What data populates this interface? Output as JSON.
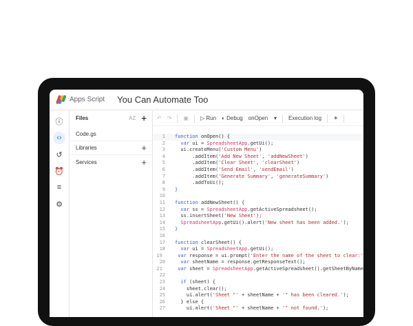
{
  "header": {
    "app_name": "Apps Script",
    "project_title": "You Can Automate Too"
  },
  "rail": [
    {
      "icon": "info-icon",
      "glyph": "ⓘ"
    },
    {
      "icon": "code-icon",
      "glyph": "‹›",
      "active": true
    },
    {
      "icon": "history-icon",
      "glyph": "↺"
    },
    {
      "icon": "triggers-icon",
      "glyph": "⏰"
    },
    {
      "icon": "executions-icon",
      "glyph": "≡"
    },
    {
      "icon": "settings-icon",
      "glyph": "⚙"
    }
  ],
  "files": {
    "title": "Files",
    "sort": "AZ",
    "items": [
      "Code.gs"
    ],
    "libraries": "Libraries",
    "services": "Services"
  },
  "toolbar": {
    "run": "Run",
    "debug": "Debug",
    "function": "onOpen",
    "log": "Execution log"
  },
  "code": [
    [
      [
        "function ",
        "k"
      ],
      [
        "onOpen() {",
        "p"
      ]
    ],
    [
      [
        "  var ",
        "k"
      ],
      [
        "ui = ",
        "p"
      ],
      [
        "SpreadsheetApp",
        "c"
      ],
      [
        ".getUi();",
        "p"
      ]
    ],
    [
      [
        "  ui.createMenu(",
        "p"
      ],
      [
        "'Custom Menu'",
        "s"
      ],
      [
        ")",
        "p"
      ]
    ],
    [
      [
        "      .addItem(",
        "p"
      ],
      [
        "'Add New Sheet'",
        "s"
      ],
      [
        ", ",
        "p"
      ],
      [
        "'addNewSheet'",
        "s"
      ],
      [
        ")",
        "p"
      ]
    ],
    [
      [
        "      .addItem(",
        "p"
      ],
      [
        "'Clear Sheet'",
        "s"
      ],
      [
        ", ",
        "p"
      ],
      [
        "'clearSheet'",
        "s"
      ],
      [
        ")",
        "p"
      ]
    ],
    [
      [
        "      .addItem(",
        "p"
      ],
      [
        "'Send Email'",
        "s"
      ],
      [
        ", ",
        "p"
      ],
      [
        "'sendEmail'",
        "s"
      ],
      [
        ")",
        "p"
      ]
    ],
    [
      [
        "      .addItem(",
        "p"
      ],
      [
        "'Generate Summary'",
        "s"
      ],
      [
        ", ",
        "p"
      ],
      [
        "'generateSummary'",
        "s"
      ],
      [
        ")",
        "p"
      ]
    ],
    [
      [
        "      .addToUi();",
        "p"
      ]
    ],
    [
      [
        "}",
        "k"
      ]
    ],
    [],
    [
      [
        "function ",
        "k"
      ],
      [
        "addNewSheet() {",
        "p"
      ]
    ],
    [
      [
        "  var ",
        "k"
      ],
      [
        "ss = ",
        "p"
      ],
      [
        "SpreadsheetApp",
        "c"
      ],
      [
        ".getActiveSpreadsheet();",
        "p"
      ]
    ],
    [
      [
        "  ss.insertSheet(",
        "p"
      ],
      [
        "'New Sheet'",
        "s"
      ],
      [
        ");",
        "p"
      ]
    ],
    [
      [
        "  SpreadsheetApp",
        "c"
      ],
      [
        ".getUi().alert(",
        "p"
      ],
      [
        "'New sheet has been added.'",
        "s"
      ],
      [
        ");",
        "p"
      ]
    ],
    [
      [
        "}",
        "k"
      ]
    ],
    [],
    [
      [
        "function ",
        "k"
      ],
      [
        "clearSheet() {",
        "p"
      ]
    ],
    [
      [
        "  var ",
        "k"
      ],
      [
        "ui = ",
        "p"
      ],
      [
        "SpreadsheetApp",
        "c"
      ],
      [
        ".getUi();",
        "p"
      ]
    ],
    [
      [
        "  var ",
        "k"
      ],
      [
        "response = ui.prompt(",
        "p"
      ],
      [
        "'Enter the name of the sheet to clear:'",
        "s"
      ]
    ],
    [
      [
        "  var ",
        "k"
      ],
      [
        "sheetName = response.getResponseText();",
        "p"
      ]
    ],
    [
      [
        "  var ",
        "k"
      ],
      [
        "sheet = ",
        "p"
      ],
      [
        "SpreadsheetApp",
        "c"
      ],
      [
        ".getActiveSpreadsheet().getSheetByName",
        "p"
      ]
    ],
    [],
    [
      [
        "  if ",
        "k"
      ],
      [
        "(sheet) {",
        "p"
      ]
    ],
    [
      [
        "    sheet.clear();",
        "p"
      ]
    ],
    [
      [
        "    ui.alert(",
        "p"
      ],
      [
        "'Sheet \"'",
        "s"
      ],
      [
        " + sheetName + ",
        "p"
      ],
      [
        "'\" has been cleared.'",
        "s"
      ],
      [
        ");",
        "p"
      ]
    ],
    [
      [
        "  } else {",
        "p"
      ]
    ],
    [
      [
        "    ui.alert(",
        "p"
      ],
      [
        "'Sheet \"'",
        "s"
      ],
      [
        " + sheetName + ",
        "p"
      ],
      [
        "'\" not found.'",
        "s"
      ],
      [
        ");",
        "p"
      ]
    ]
  ]
}
